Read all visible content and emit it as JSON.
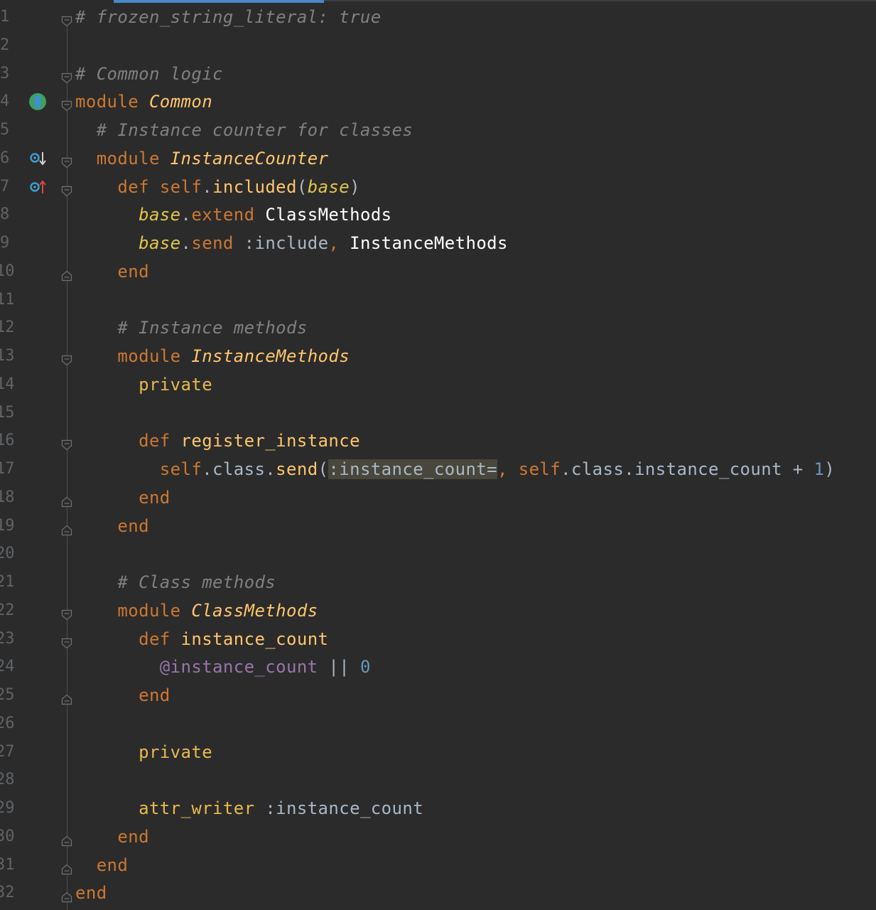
{
  "editor": {
    "language": "ruby",
    "accent_color": "#4a88c7",
    "background": "#2b2b2b",
    "lines": [
      {
        "n": "1",
        "tokens": [
          {
            "t": "# frozen_string_literal: true",
            "c": "cm"
          }
        ]
      },
      {
        "n": "2",
        "tokens": []
      },
      {
        "n": "3",
        "tokens": [
          {
            "t": "# Common logic",
            "c": "cm"
          }
        ]
      },
      {
        "n": "4",
        "tokens": [
          {
            "t": "module ",
            "c": "kw"
          },
          {
            "t": "Common",
            "c": "cn"
          }
        ]
      },
      {
        "n": "5",
        "tokens": [
          {
            "t": "  ",
            "c": "sy"
          },
          {
            "t": "# Instance counter for classes",
            "c": "cm"
          }
        ]
      },
      {
        "n": "6",
        "tokens": [
          {
            "t": "  ",
            "c": "sy"
          },
          {
            "t": "module ",
            "c": "kw"
          },
          {
            "t": "InstanceCounter",
            "c": "cn"
          }
        ]
      },
      {
        "n": "7",
        "tokens": [
          {
            "t": "    ",
            "c": "sy"
          },
          {
            "t": "def ",
            "c": "kw"
          },
          {
            "t": "self",
            "c": "self"
          },
          {
            "t": ".",
            "c": "sy"
          },
          {
            "t": "included",
            "c": "mn"
          },
          {
            "t": "(",
            "c": "sy"
          },
          {
            "t": "base",
            "c": "prm"
          },
          {
            "t": ")",
            "c": "sy"
          }
        ]
      },
      {
        "n": "8",
        "tokens": [
          {
            "t": "      ",
            "c": "sy"
          },
          {
            "t": "base",
            "c": "prm"
          },
          {
            "t": ".",
            "c": "sy"
          },
          {
            "t": "extend ",
            "c": "kw"
          },
          {
            "t": "ClassMethods",
            "c": "wh"
          }
        ]
      },
      {
        "n": "9",
        "tokens": [
          {
            "t": "      ",
            "c": "sy"
          },
          {
            "t": "base",
            "c": "prm"
          },
          {
            "t": ".",
            "c": "sy"
          },
          {
            "t": "send ",
            "c": "kw"
          },
          {
            "t": ":include",
            "c": "sym"
          },
          {
            "t": ", ",
            "c": "kw"
          },
          {
            "t": "InstanceMethods",
            "c": "wh"
          }
        ]
      },
      {
        "n": "10",
        "tokens": [
          {
            "t": "    ",
            "c": "sy"
          },
          {
            "t": "end",
            "c": "kw"
          }
        ]
      },
      {
        "n": "11",
        "tokens": []
      },
      {
        "n": "12",
        "tokens": [
          {
            "t": "    ",
            "c": "sy"
          },
          {
            "t": "# Instance methods",
            "c": "cm"
          }
        ]
      },
      {
        "n": "13",
        "tokens": [
          {
            "t": "    ",
            "c": "sy"
          },
          {
            "t": "module ",
            "c": "kw"
          },
          {
            "t": "InstanceMethods",
            "c": "cn"
          }
        ]
      },
      {
        "n": "14",
        "tokens": [
          {
            "t": "      ",
            "c": "sy"
          },
          {
            "t": "private",
            "c": "pv"
          }
        ]
      },
      {
        "n": "15",
        "tokens": []
      },
      {
        "n": "16",
        "tokens": [
          {
            "t": "      ",
            "c": "sy"
          },
          {
            "t": "def ",
            "c": "kw"
          },
          {
            "t": "register_instance",
            "c": "mn"
          }
        ]
      },
      {
        "n": "17",
        "tokens": [
          {
            "t": "        ",
            "c": "sy"
          },
          {
            "t": "self",
            "c": "self"
          },
          {
            "t": ".class.",
            "c": "sy"
          },
          {
            "t": "send",
            "c": "mn"
          },
          {
            "t": "(",
            "c": "sy"
          },
          {
            "t": ":instance_count=",
            "c": "sym hl"
          },
          {
            "t": ", ",
            "c": "kw"
          },
          {
            "t": "self",
            "c": "self"
          },
          {
            "t": ".class.instance_count + ",
            "c": "sy"
          },
          {
            "t": "1",
            "c": "num"
          },
          {
            "t": ")",
            "c": "sy"
          }
        ]
      },
      {
        "n": "18",
        "tokens": [
          {
            "t": "      ",
            "c": "sy"
          },
          {
            "t": "end",
            "c": "kw"
          }
        ]
      },
      {
        "n": "19",
        "tokens": [
          {
            "t": "    ",
            "c": "sy"
          },
          {
            "t": "end",
            "c": "kw"
          }
        ]
      },
      {
        "n": "20",
        "tokens": []
      },
      {
        "n": "21",
        "tokens": [
          {
            "t": "    ",
            "c": "sy"
          },
          {
            "t": "# Class methods",
            "c": "cm"
          }
        ]
      },
      {
        "n": "22",
        "tokens": [
          {
            "t": "    ",
            "c": "sy"
          },
          {
            "t": "module ",
            "c": "kw"
          },
          {
            "t": "ClassMethods",
            "c": "cn"
          }
        ]
      },
      {
        "n": "23",
        "tokens": [
          {
            "t": "      ",
            "c": "sy"
          },
          {
            "t": "def ",
            "c": "kw"
          },
          {
            "t": "instance_count",
            "c": "mn"
          }
        ]
      },
      {
        "n": "24",
        "tokens": [
          {
            "t": "        ",
            "c": "sy"
          },
          {
            "t": "@instance_count",
            "c": "iv"
          },
          {
            "t": " || ",
            "c": "sy"
          },
          {
            "t": "0",
            "c": "num"
          }
        ]
      },
      {
        "n": "25",
        "tokens": [
          {
            "t": "      ",
            "c": "sy"
          },
          {
            "t": "end",
            "c": "kw"
          }
        ]
      },
      {
        "n": "26",
        "tokens": []
      },
      {
        "n": "27",
        "tokens": [
          {
            "t": "      ",
            "c": "sy"
          },
          {
            "t": "private",
            "c": "pv"
          }
        ]
      },
      {
        "n": "28",
        "tokens": []
      },
      {
        "n": "29",
        "tokens": [
          {
            "t": "      ",
            "c": "sy"
          },
          {
            "t": "attr_writer ",
            "c": "pv"
          },
          {
            "t": ":instance_count",
            "c": "sym"
          }
        ]
      },
      {
        "n": "30",
        "tokens": [
          {
            "t": "    ",
            "c": "sy"
          },
          {
            "t": "end",
            "c": "kw"
          }
        ]
      },
      {
        "n": "31",
        "tokens": [
          {
            "t": "  ",
            "c": "sy"
          },
          {
            "t": "end",
            "c": "kw"
          }
        ]
      },
      {
        "n": "32",
        "tokens": [
          {
            "t": "end",
            "c": "kw"
          }
        ]
      }
    ],
    "gutter_icons": [
      {
        "line": "4",
        "icon": "implemented-module-icon"
      },
      {
        "line": "6",
        "icon": "override-down-icon"
      },
      {
        "line": "7",
        "icon": "override-up-icon"
      }
    ],
    "fold_markers": [
      {
        "line": "1",
        "kind": "open"
      },
      {
        "line": "3",
        "kind": "open"
      },
      {
        "line": "4",
        "kind": "open"
      },
      {
        "line": "6",
        "kind": "open"
      },
      {
        "line": "7",
        "kind": "open"
      },
      {
        "line": "10",
        "kind": "close"
      },
      {
        "line": "13",
        "kind": "open"
      },
      {
        "line": "16",
        "kind": "open"
      },
      {
        "line": "18",
        "kind": "close"
      },
      {
        "line": "19",
        "kind": "close"
      },
      {
        "line": "22",
        "kind": "open"
      },
      {
        "line": "23",
        "kind": "open"
      },
      {
        "line": "25",
        "kind": "close"
      },
      {
        "line": "30",
        "kind": "close"
      },
      {
        "line": "31",
        "kind": "close"
      },
      {
        "line": "32",
        "kind": "close"
      }
    ]
  }
}
